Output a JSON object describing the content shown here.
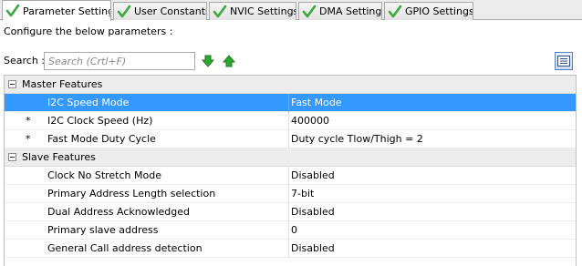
{
  "tabs": [
    {
      "label": "Parameter Settings",
      "active": true
    },
    {
      "label": "User Constants",
      "active": false
    },
    {
      "label": "NVIC Settings",
      "active": false
    },
    {
      "label": "DMA Settings",
      "active": false
    },
    {
      "label": "GPIO Settings",
      "active": false
    }
  ],
  "configure_text": "Configure the below parameters :",
  "search": {
    "label": "Search :",
    "placeholder": "Search (Crtl+F)"
  },
  "groups": [
    {
      "title": "Master Features",
      "params": [
        {
          "star": "",
          "name": "I2C Speed Mode",
          "value": "Fast Mode",
          "selected": true
        },
        {
          "star": "*",
          "name": "I2C Clock Speed (Hz)",
          "value": "400000",
          "selected": false
        },
        {
          "star": "*",
          "name": "Fast Mode Duty Cycle",
          "value": "Duty cycle Tlow/Thigh = 2",
          "selected": false
        }
      ]
    },
    {
      "title": "Slave Features",
      "params": [
        {
          "star": "",
          "name": "Clock No Stretch Mode",
          "value": "Disabled",
          "selected": false
        },
        {
          "star": "",
          "name": "Primary Address Length selection",
          "value": "7-bit",
          "selected": false
        },
        {
          "star": "",
          "name": "Dual Address Acknowledged",
          "value": "Disabled",
          "selected": false
        },
        {
          "star": "",
          "name": "Primary slave address",
          "value": "0",
          "selected": false
        },
        {
          "star": "",
          "name": "General Call address detection",
          "value": "Disabled",
          "selected": false
        }
      ]
    }
  ],
  "colors": {
    "selected_row": "#3399ff",
    "check_green": "#3aa83a",
    "arrow_green": "#2fa82f"
  },
  "icons": {
    "tab": "check-icon",
    "down": "arrow-down-icon",
    "up": "arrow-up-icon",
    "view": "list-view-icon"
  }
}
